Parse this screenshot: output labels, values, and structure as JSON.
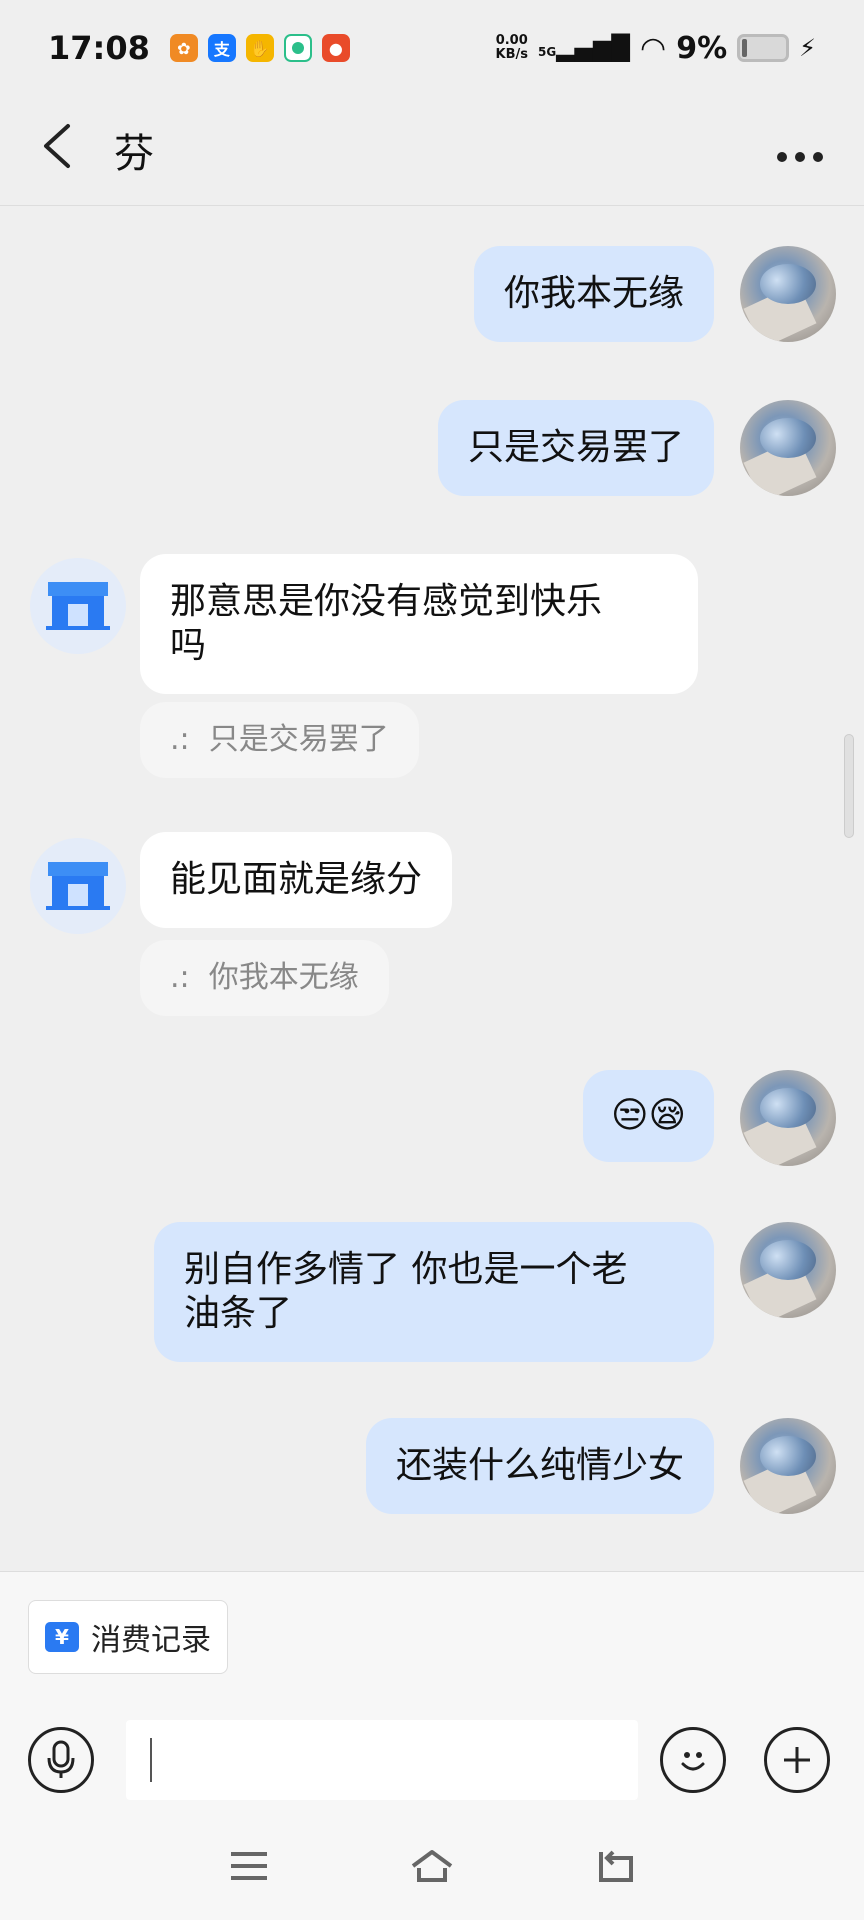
{
  "status_bar": {
    "time": "17:08",
    "netspeed_value": "0.00",
    "netspeed_unit": "KB/s",
    "signal": "5G",
    "battery": "9%"
  },
  "header": {
    "back_icon": "chevron-left-icon",
    "title": "芬",
    "more_icon": "more-icon"
  },
  "messages": [
    {
      "from": "me",
      "text": "你我本无缘"
    },
    {
      "from": "me",
      "text": "只是交易罢了"
    },
    {
      "from": "them",
      "text": "那意思是你没有感觉到快乐吗",
      "line1": "那意思是你没有感觉到快乐",
      "line2": "吗",
      "quote_prefix": ".:",
      "quote": "只是交易罢了"
    },
    {
      "from": "them",
      "text": "能见面就是缘分",
      "quote_prefix": ".:",
      "quote": "你我本无缘"
    },
    {
      "from": "me",
      "text": "😒😪"
    },
    {
      "from": "me",
      "text": "别自作多情了 你也是一个老油条了",
      "line1": "别自作多情了 你也是一个老",
      "line2": "油条了"
    },
    {
      "from": "me",
      "text": "还装什么纯情少女"
    }
  ],
  "bottom": {
    "record_label": "消费记录",
    "record_icon_glyph": "¥",
    "input_placeholder": ""
  },
  "colors": {
    "my_bubble": "#d6e6fd",
    "their_bubble": "#ffffff",
    "background": "#efefef",
    "accent": "#2a7af2"
  }
}
